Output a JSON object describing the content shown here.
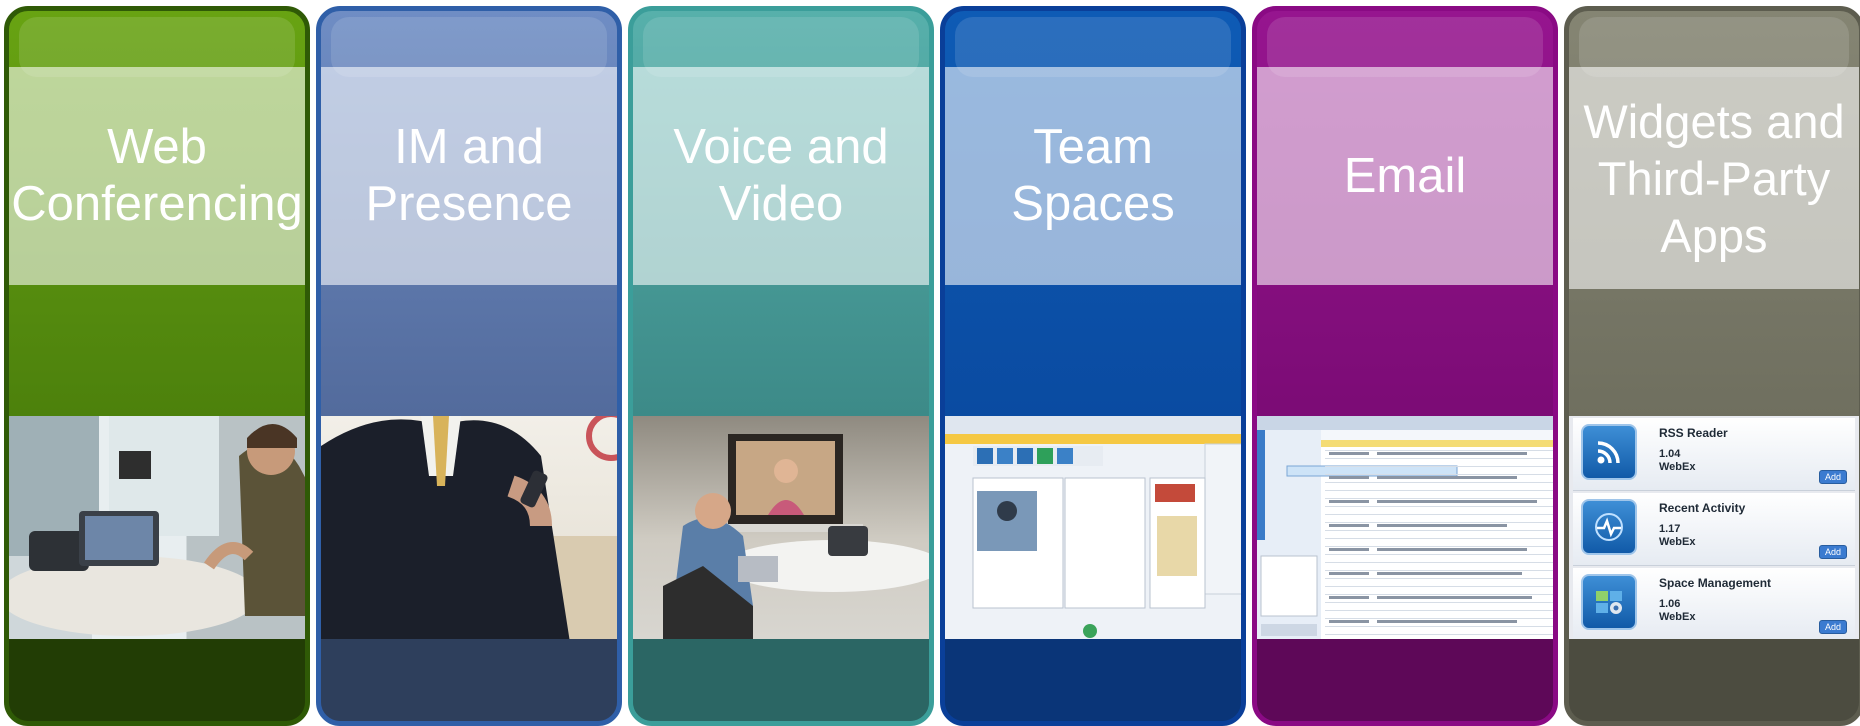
{
  "panels": [
    {
      "title": "Web\nConferencing"
    },
    {
      "title": "IM and\nPresence"
    },
    {
      "title": "Voice and\nVideo"
    },
    {
      "title": "Team\nSpaces"
    },
    {
      "title": "Email"
    },
    {
      "title": "Widgets and\nThird-Party\nApps"
    }
  ],
  "widgets": [
    {
      "name": "RSS Reader",
      "version": "1.04",
      "vendor": "WebEx",
      "add": "Add",
      "icon": "rss-icon"
    },
    {
      "name": "Recent Activity",
      "version": "1.17",
      "vendor": "WebEx",
      "add": "Add",
      "icon": "activity-icon"
    },
    {
      "name": "Space Management",
      "version": "1.06",
      "vendor": "WebEx",
      "add": "Add",
      "icon": "window-gear-icon"
    }
  ]
}
